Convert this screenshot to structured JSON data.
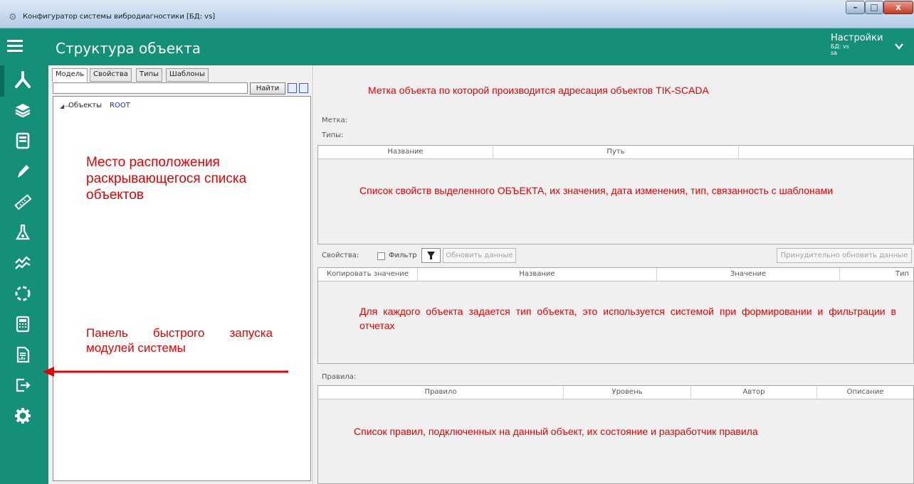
{
  "window": {
    "title": "Конфигуратор системы вибродиагностики [БД: vs]",
    "controls": {
      "minimize": "–",
      "maximize": "□",
      "close": "x"
    }
  },
  "header": {
    "title": "Структура объекта",
    "settings_label": "Настройки",
    "db_label": "БД: vs",
    "user_label": "sa"
  },
  "colors": {
    "primary": "#139077",
    "annotation": "#e60000",
    "root_link": "#1b2fd6"
  },
  "sidebar": {
    "items": [
      {
        "icon": "object-structure-icon",
        "selected": true
      },
      {
        "icon": "layers-icon"
      },
      {
        "icon": "device-icon"
      },
      {
        "icon": "pencil-icon"
      },
      {
        "icon": "ruler-icon"
      },
      {
        "icon": "flask-icon"
      },
      {
        "icon": "trend-chart-icon"
      },
      {
        "icon": "dashed-circle-icon"
      },
      {
        "icon": "calculator-icon"
      },
      {
        "icon": "report-icon"
      },
      {
        "icon": "exit-icon"
      },
      {
        "icon": "gear-icon"
      }
    ]
  },
  "tree_panel": {
    "tabs": [
      "Модель",
      "Свойства",
      "Типы",
      "Шаблоны"
    ],
    "active_tab": "Модель",
    "search_value": "",
    "find_button": "Найти",
    "tree_node_label": "Объекты",
    "tree_node_root": "ROOT"
  },
  "annotations": {
    "tree_area": "Место расположения раскрывающегося списка объектов",
    "sidebar": "Панель быстрого запуска модулей системы",
    "mark": "Метка объекта по которой производится адресация объектов TIK-SCADA",
    "types": "Список свойств выделенного ОБЪЕКТА, их значения, дата изменения, тип, связанность с шаблонами",
    "properties": "Для каждого объекта задается тип объекта, это используется системой при формировании и фильтрации в отчетах",
    "rules": "Список правил, подключенных на данный объект, их состояние и разработчик правила"
  },
  "details": {
    "mark_label": "Метка:",
    "types_label": "Типы:",
    "types_columns": [
      "Название",
      "Путь",
      ""
    ],
    "properties_label": "Свойства:",
    "filter_label": "Фильтр",
    "refresh_button": "Обновить данные",
    "force_refresh_button": "Принудительно обновить данные",
    "properties_columns": [
      "Копировать значение",
      "Название",
      "Значение",
      "Тип"
    ],
    "rules_label": "Правила:",
    "rules_columns": [
      "Правило",
      "Уровень",
      "Автор",
      "Описание"
    ]
  }
}
